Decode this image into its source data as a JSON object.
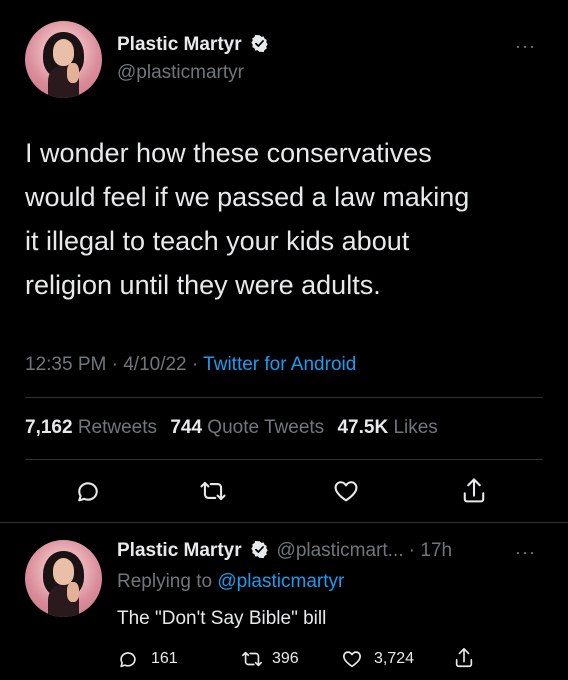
{
  "main_tweet": {
    "author_name": "Plastic Martyr",
    "author_handle": "@plasticmartyr",
    "more_glyph": "···",
    "text_lines": [
      "I wonder how these conservatives",
      "would feel if we passed a law making",
      "it illegal to teach your kids about",
      "religion until they were adults."
    ],
    "time": "12:35 PM",
    "separator": "·",
    "date": "4/10/22",
    "source": "Twitter for Android",
    "retweets_count": "7,162",
    "retweets_label": "Retweets",
    "quotes_count": "744",
    "quotes_label": "Quote Tweets",
    "likes_count": "47.5K",
    "likes_label": "Likes"
  },
  "reply_tweet": {
    "author_name": "Plastic Martyr",
    "author_handle_time": "@plasticmart... · 17h",
    "more_glyph": "···",
    "replying_prefix": "Replying to",
    "replying_handle": "@plasticmartyr",
    "text": "The \"Don't Say Bible\" bill",
    "reply_count": "161",
    "retweet_count": "396",
    "like_count": "3,724"
  },
  "colors": {
    "background": "#000000",
    "text": "#e7e9ea",
    "muted": "#71767b",
    "link": "#1d9bf0",
    "divider": "#2f3336"
  },
  "icons": {
    "verified": "verified-badge-icon",
    "reply": "reply-bubble-icon",
    "retweet": "retweet-arrows-icon",
    "like": "heart-icon",
    "share": "share-upload-icon",
    "more": "more-dots-icon"
  }
}
